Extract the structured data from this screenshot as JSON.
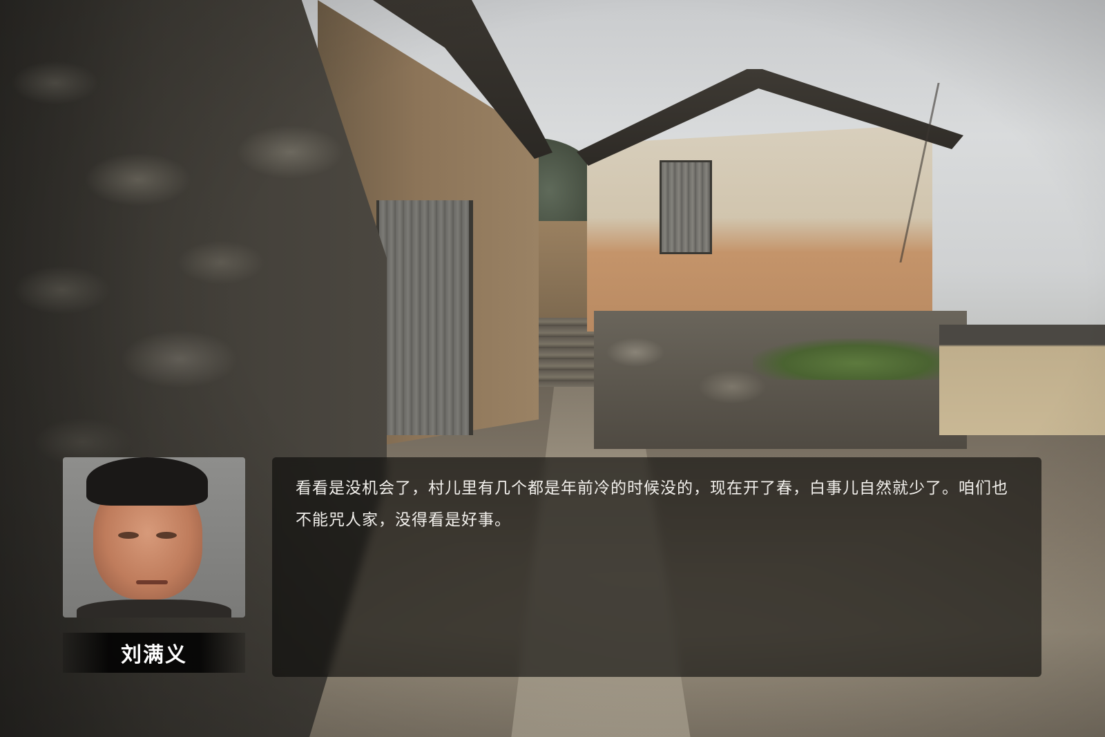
{
  "speaker": {
    "name": "刘满义",
    "portrait_icon": "speaker-portrait"
  },
  "dialogue": {
    "text": "看看是没机会了，村儿里有几个都是年前冷的时候没的，现在开了春，白事儿自然就少了。咱们也不能咒人家，没得看是好事。"
  },
  "colors": {
    "dialogue_bg": "#0a0908",
    "text": "#f2f0ec",
    "name_plate_bg": "#000000"
  }
}
